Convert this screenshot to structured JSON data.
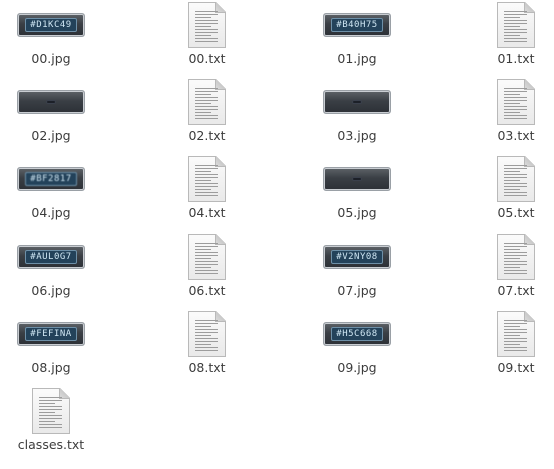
{
  "files": [
    {
      "name": "00.jpg",
      "kind": "image",
      "plate_text": "#D1KC49",
      "style": "normal",
      "icon": "image-thumbnail-icon"
    },
    {
      "name": "00.txt",
      "kind": "text",
      "icon": "text-file-icon"
    },
    {
      "name": "01.jpg",
      "kind": "image",
      "plate_text": "#B40H75",
      "style": "normal",
      "icon": "image-thumbnail-icon"
    },
    {
      "name": "01.txt",
      "kind": "text",
      "icon": "text-file-icon"
    },
    {
      "name": "02.jpg",
      "kind": "image",
      "plate_text": "",
      "style": "dark",
      "icon": "image-thumbnail-icon"
    },
    {
      "name": "02.txt",
      "kind": "text",
      "icon": "text-file-icon"
    },
    {
      "name": "03.jpg",
      "kind": "image",
      "plate_text": "",
      "style": "dark",
      "icon": "image-thumbnail-icon"
    },
    {
      "name": "03.txt",
      "kind": "text",
      "icon": "text-file-icon"
    },
    {
      "name": "04.jpg",
      "kind": "image",
      "plate_text": "#BF2817",
      "style": "blur",
      "icon": "image-thumbnail-icon"
    },
    {
      "name": "04.txt",
      "kind": "text",
      "icon": "text-file-icon"
    },
    {
      "name": "05.jpg",
      "kind": "image",
      "plate_text": "",
      "style": "dark",
      "icon": "image-thumbnail-icon"
    },
    {
      "name": "05.txt",
      "kind": "text",
      "icon": "text-file-icon"
    },
    {
      "name": "06.jpg",
      "kind": "image",
      "plate_text": "#AUL0G7",
      "style": "normal",
      "icon": "image-thumbnail-icon"
    },
    {
      "name": "06.txt",
      "kind": "text",
      "icon": "text-file-icon"
    },
    {
      "name": "07.jpg",
      "kind": "image",
      "plate_text": "#V2NY08",
      "style": "normal",
      "icon": "image-thumbnail-icon"
    },
    {
      "name": "07.txt",
      "kind": "text",
      "icon": "text-file-icon"
    },
    {
      "name": "08.jpg",
      "kind": "image",
      "plate_text": "#FEFINA",
      "style": "normal",
      "icon": "image-thumbnail-icon"
    },
    {
      "name": "08.txt",
      "kind": "text",
      "icon": "text-file-icon"
    },
    {
      "name": "09.jpg",
      "kind": "image",
      "plate_text": "#H5C668",
      "style": "normal",
      "icon": "image-thumbnail-icon"
    },
    {
      "name": "09.txt",
      "kind": "text",
      "icon": "text-file-icon"
    },
    {
      "name": "classes.txt",
      "kind": "text",
      "icon": "text-file-icon"
    }
  ]
}
